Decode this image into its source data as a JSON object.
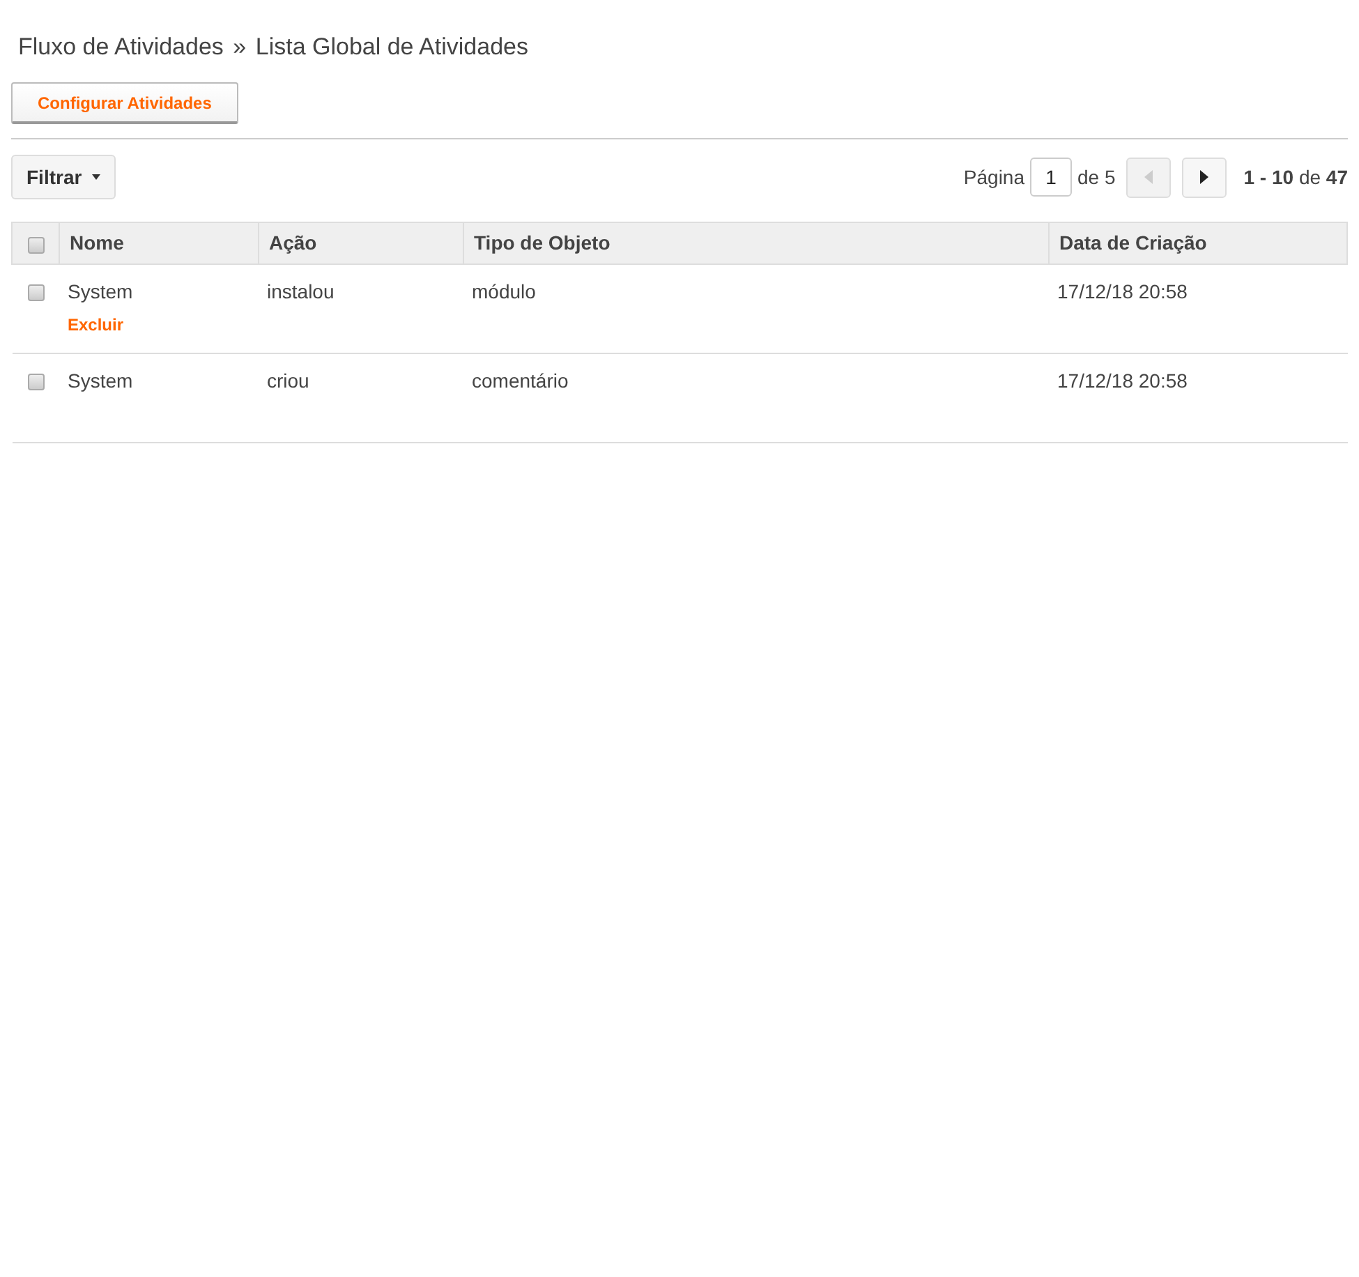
{
  "breadcrumb": {
    "parent": "Fluxo de Atividades",
    "separator": "»",
    "current": "Lista Global de Atividades"
  },
  "config_button": "Configurar Atividades",
  "filter_button": "Filtrar",
  "pagination": {
    "label": "Página",
    "page": "1",
    "of_label": "de 5",
    "prev_disabled": true,
    "next_disabled": false,
    "range": "1 - 10",
    "range_of": "de",
    "total": "47"
  },
  "table": {
    "select_all_checked": false,
    "columns": [
      "Nome",
      "Ação",
      "Tipo de Objeto",
      "Data de Criação"
    ],
    "rows": [
      {
        "checked": false,
        "cells": [
          "System",
          "instalou",
          "módulo",
          "17/12/18 20:58"
        ],
        "actions": [
          "Excluir"
        ]
      },
      {
        "checked": false,
        "cells": [
          "System",
          "criou",
          "comentário",
          "17/12/18 20:58"
        ],
        "actions": []
      }
    ]
  }
}
